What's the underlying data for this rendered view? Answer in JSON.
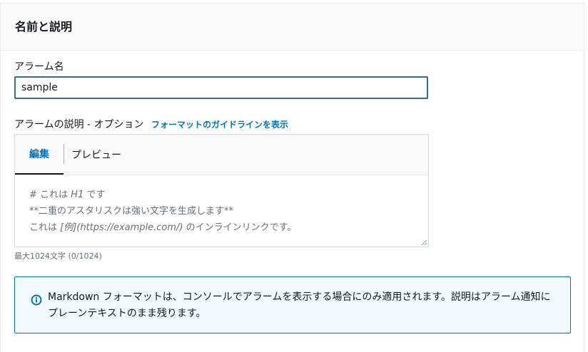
{
  "panel": {
    "title": "名前と説明"
  },
  "alarm_name": {
    "label": "アラーム名",
    "value": "sample"
  },
  "alarm_description": {
    "label": "アラームの説明 - オプション",
    "guide_link": "フォーマットのガイドラインを表示",
    "tabs": {
      "edit": "編集",
      "preview": "プレビュー"
    },
    "placeholder_lines": {
      "line1_prefix": "# これは ",
      "line1_em": "H1",
      "line1_suffix": " です",
      "line2": "**二重のアスタリスクは強い文字を生成します**",
      "line3_prefix": "これは ",
      "line3_em": "[例](https://example.com/)",
      "line3_suffix": " のインラインリンクです。"
    },
    "char_count": "最大1024文字 (0/1024)"
  },
  "info": {
    "text": "Markdown フォーマットは、コンソールでアラームを表示する場合にのみ適用されます。説明はアラーム通知にプレーンテキストのまま残ります。",
    "icon": "info-icon"
  },
  "colors": {
    "accent": "#0073bb",
    "info_bg": "#f1faff"
  }
}
